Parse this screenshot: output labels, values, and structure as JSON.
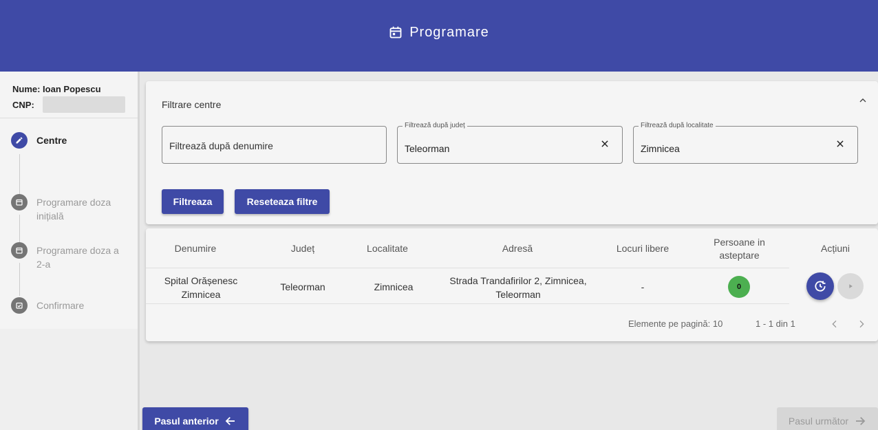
{
  "header": {
    "title": "Programare",
    "icon": "calendar-icon"
  },
  "user": {
    "name_label": "Nume: Ioan Popescu",
    "cnp_label": "CNP:"
  },
  "steps": [
    {
      "label": "Centre",
      "status": "active",
      "icon": "edit-icon"
    },
    {
      "label": "Programare doza inițială",
      "status": "pending",
      "icon": "calendar-icon"
    },
    {
      "label": "Programare doza a 2-a",
      "status": "pending",
      "icon": "calendar-icon"
    },
    {
      "label": "Confirmare",
      "status": "pending",
      "icon": "check-calendar-icon"
    }
  ],
  "filters": {
    "title": "Filtrare centre",
    "name_placeholder": "Filtrează după denumire",
    "county_label": "Filtrează după județ",
    "county_value": "Teleorman",
    "locality_label": "Filtrează după localitate",
    "locality_value": "Zimnicea",
    "filter_button": "Filtreaza",
    "reset_button": "Reseteaza filtre"
  },
  "table": {
    "columns": [
      "Denumire",
      "Județ",
      "Localitate",
      "Adresă",
      "Locuri libere",
      "Persoane in asteptare",
      "Acțiuni"
    ],
    "rows": [
      {
        "name": "Spital Orășenesc Zimnicea",
        "county": "Teleorman",
        "locality": "Zimnicea",
        "address": "Strada Trandafirilor 2, Zimnicea, Teleorman",
        "free_places": "-",
        "waiting": "0"
      }
    ],
    "page_size_label": "Elemente pe pagină: 10",
    "range_label": "1 - 1 din 1"
  },
  "nav": {
    "prev_label": "Pasul anterior",
    "next_label": "Pasul următor"
  },
  "colors": {
    "primary": "#3f4aa6",
    "badge_green": "#4caf50"
  }
}
